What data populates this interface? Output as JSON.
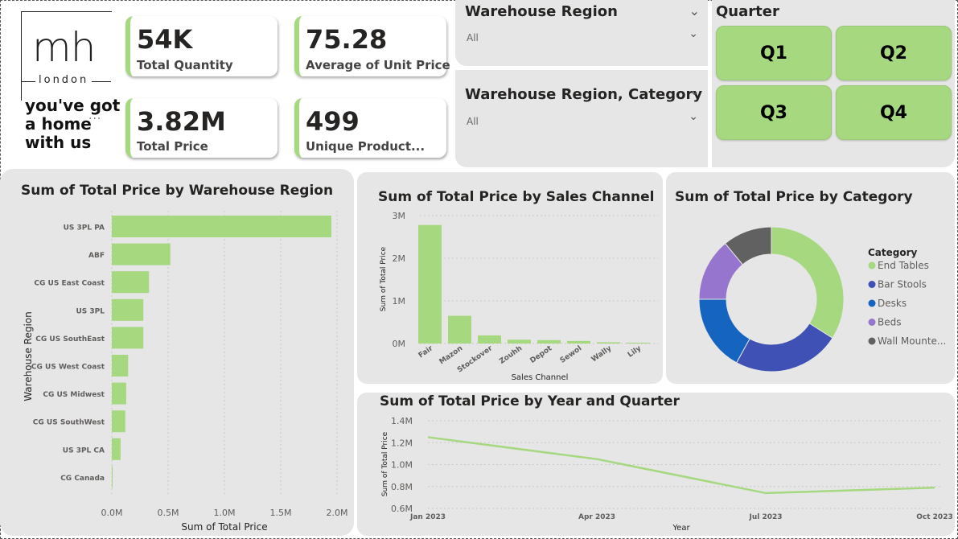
{
  "logo": {
    "mark": "mh",
    "sub": "london"
  },
  "tagline": [
    "you've got",
    "a home",
    "with us"
  ],
  "more_indicator": "...",
  "kpis": [
    {
      "value": "54K",
      "label": "Total Quantity"
    },
    {
      "value": "75.28",
      "label": "Average of Unit Price"
    },
    {
      "value": "3.82M",
      "label": "Total Price"
    },
    {
      "value": "499",
      "label": "Unique Product..."
    }
  ],
  "slicers": [
    {
      "title": "Warehouse Region",
      "value": "All"
    },
    {
      "title": "Warehouse Region, Category",
      "value": "All"
    }
  ],
  "quarter_slicer": {
    "title": "Quarter",
    "options": [
      "Q1",
      "Q2",
      "Q3",
      "Q4"
    ]
  },
  "icons": {
    "dropdown": "chevron-down-icon"
  },
  "colors": {
    "accent": "#a6d87f",
    "panel": "#e6e6e6"
  },
  "chart_data": [
    {
      "id": "region",
      "type": "bar",
      "orientation": "horizontal",
      "title": "Sum of Total Price by Warehouse Region",
      "xlabel": "Sum of Total Price",
      "ylabel": "Warehouse Region",
      "categories": [
        "US 3PL PA",
        "ABF",
        "CG US East Coast",
        "US 3PL",
        "CG US SouthEast",
        "CG US West Coast",
        "CG US Midwest",
        "CG US SouthWest",
        "US 3PL CA",
        "CG Canada"
      ],
      "values": [
        1950000,
        520000,
        330000,
        280000,
        280000,
        145000,
        128000,
        120000,
        78000,
        6000
      ],
      "xticks": [
        "0.0M",
        "0.5M",
        "1.0M",
        "1.5M",
        "2.0M"
      ],
      "xlim": [
        0,
        2000000
      ],
      "grid": true,
      "color": "#a6d87f"
    },
    {
      "id": "channel",
      "type": "bar",
      "title": "Sum of Total Price by Sales Channel",
      "xlabel": "Sales Channel",
      "ylabel": "Sum of Total Price",
      "categories": [
        "Fair",
        "Mazon",
        "Stockover",
        "Zouhh",
        "Depot",
        "Sewol",
        "Wally",
        "Lily"
      ],
      "values": [
        2780000,
        650000,
        190000,
        90000,
        80000,
        60000,
        30000,
        20000
      ],
      "yticks": [
        "0M",
        "1M",
        "2M",
        "3M"
      ],
      "ylim": [
        0,
        3000000
      ],
      "grid": true,
      "color": "#a6d87f"
    },
    {
      "id": "category",
      "type": "pie",
      "donut": true,
      "title": "Sum of Total Price by Category",
      "legend_title": "Category",
      "legend_position": "right",
      "slices": [
        {
          "name": "End Tables",
          "value": 34,
          "color": "#a6d87f"
        },
        {
          "name": "Bar Stools",
          "value": 24,
          "color": "#3f51b5"
        },
        {
          "name": "Desks",
          "value": 17,
          "color": "#1565c0"
        },
        {
          "name": "Beds",
          "value": 14,
          "color": "#9575cd"
        },
        {
          "name": "Wall Mounte...",
          "value": 11,
          "color": "#616161"
        }
      ]
    },
    {
      "id": "year_quarter",
      "type": "line",
      "title": "Sum of Total Price by Year and Quarter",
      "xlabel": "Year",
      "ylabel": "Sum of Total Price",
      "x": [
        "Jan 2023",
        "Apr 2023",
        "Jul 2023",
        "Oct 2023"
      ],
      "values": [
        1250000,
        1050000,
        740000,
        790000
      ],
      "yticks": [
        "0.6M",
        "0.8M",
        "1.0M",
        "1.2M",
        "1.4M"
      ],
      "ylim": [
        600000,
        1400000
      ],
      "grid": true,
      "color": "#a6d87f"
    }
  ]
}
